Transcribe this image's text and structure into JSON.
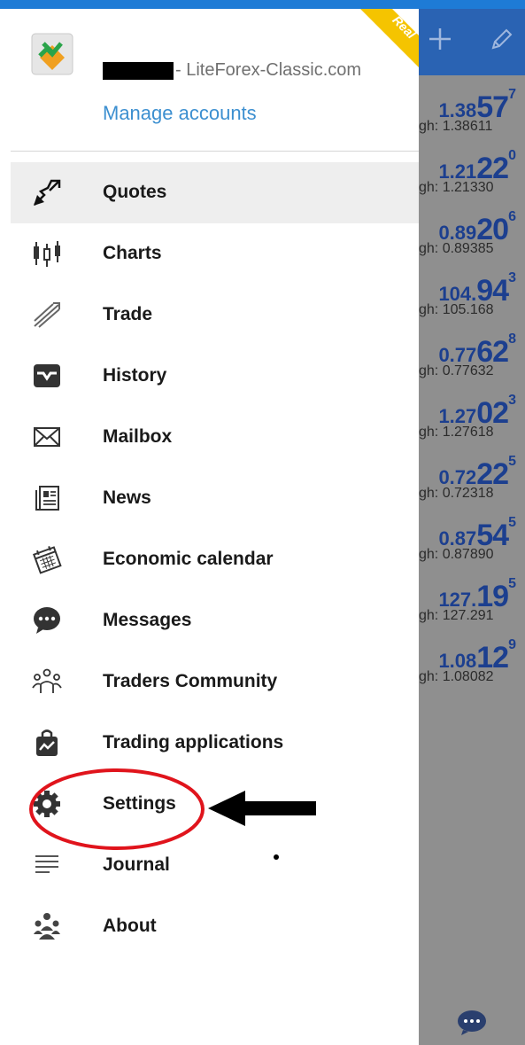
{
  "account": {
    "name_suffix": "- LiteForex-Classic.com",
    "manage_label": "Manage accounts",
    "badge": "Real"
  },
  "menu": {
    "items": [
      {
        "label": "Quotes",
        "icon": "quotes-icon",
        "selected": true
      },
      {
        "label": "Charts",
        "icon": "charts-icon"
      },
      {
        "label": "Trade",
        "icon": "trade-icon"
      },
      {
        "label": "History",
        "icon": "history-icon"
      },
      {
        "label": "Mailbox",
        "icon": "mailbox-icon"
      },
      {
        "label": "News",
        "icon": "news-icon"
      },
      {
        "label": "Economic calendar",
        "icon": "calendar-icon"
      },
      {
        "label": "Messages",
        "icon": "messages-icon"
      },
      {
        "label": "Traders Community",
        "icon": "community-icon"
      },
      {
        "label": "Trading applications",
        "icon": "applications-icon"
      },
      {
        "label": "Settings",
        "icon": "gear-icon"
      },
      {
        "label": "Journal",
        "icon": "journal-icon"
      },
      {
        "label": "About",
        "icon": "about-icon"
      }
    ]
  },
  "quotes": [
    {
      "p1": "1.38",
      "p2": "57",
      "p3": "7",
      "high": "gh: 1.38611"
    },
    {
      "p1": "1.21",
      "p2": "22",
      "p3": "0",
      "high": "gh: 1.21330"
    },
    {
      "p1": "0.89",
      "p2": "20",
      "p3": "6",
      "high": "gh: 0.89385"
    },
    {
      "p1": "104.",
      "p2": "94",
      "p3": "3",
      "high": "gh: 105.168"
    },
    {
      "p1": "0.77",
      "p2": "62",
      "p3": "8",
      "high": "gh: 0.77632"
    },
    {
      "p1": "1.27",
      "p2": "02",
      "p3": "3",
      "high": "gh: 1.27618"
    },
    {
      "p1": "0.72",
      "p2": "22",
      "p3": "5",
      "high": "gh: 0.72318"
    },
    {
      "p1": "0.87",
      "p2": "54",
      "p3": "5",
      "high": "gh: 0.87890"
    },
    {
      "p1": "127.",
      "p2": "19",
      "p3": "5",
      "high": "gh: 127.291"
    },
    {
      "p1": "1.08",
      "p2": "12",
      "p3": "9",
      "high": "gh: 1.08082"
    }
  ],
  "colors": {
    "accent_blue": "#1e7bd6",
    "header_blue": "#2a63b3",
    "price_blue": "#1c3f8f",
    "annotation_red": "#e0141c",
    "badge_gold": "#f5c400"
  }
}
